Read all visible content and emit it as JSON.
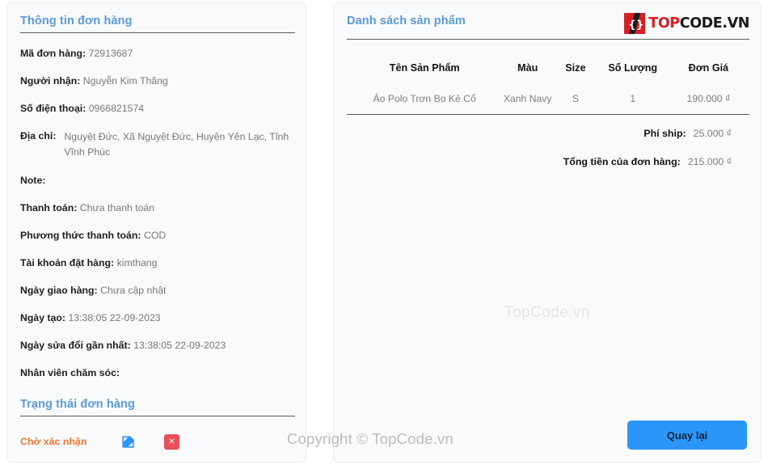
{
  "left": {
    "title": "Thông tin đơn hàng",
    "fields": [
      {
        "label": "Mã đơn hàng:",
        "value": "72913687"
      },
      {
        "label": "Người nhận:",
        "value": "Nguyễn Kim Thăng"
      },
      {
        "label": "Số điện thoại:",
        "value": "0966821574"
      },
      {
        "label": "Địa chỉ:",
        "value": "Nguyệt Đức, Xã Nguyệt Đức, Huyện Yên Lạc, Tỉnh Vĩnh Phúc"
      },
      {
        "label": "Note:",
        "value": ""
      },
      {
        "label": "Thanh toán:",
        "value": "Chưa thanh toán"
      },
      {
        "label": "Phương thức thanh toán:",
        "value": "COD"
      },
      {
        "label": "Tài khoản đặt hàng:",
        "value": "kimthang"
      },
      {
        "label": "Ngày giao hàng:",
        "value": "Chưa cập nhật"
      },
      {
        "label": "Ngày tạo:",
        "value": "13:38:05 22-09-2023"
      },
      {
        "label": "Ngày sửa đổi gần nhất:",
        "value": "13:38:05 22-09-2023"
      },
      {
        "label": "Nhân viên chăm sóc:",
        "value": ""
      }
    ],
    "status_title": "Trạng thái đơn hàng",
    "status_text": "Chờ xác nhận",
    "edit_icon": "edit-pencil-square-icon",
    "delete_icon": "close-x-icon",
    "delete_glyph": "✕"
  },
  "right": {
    "title": "Danh sách sản phẩm",
    "logo": {
      "mark_icon": "code-braces-icon",
      "text_part1": "TOP",
      "text_part2": "CODE",
      "text_part3": ".VN"
    },
    "table": {
      "headers": [
        "Tên Sản Phẩm",
        "Màu",
        "Size",
        "Số Lượng",
        "Đơn Giá"
      ],
      "rows": [
        {
          "name": "Áo Polo Trơn Bo Kẻ Cổ",
          "color": "Xanh Navy",
          "size": "S",
          "qty": "1",
          "price": "190.000 ₫"
        }
      ]
    },
    "totals": [
      {
        "label": "Phí ship:",
        "value": "25.000 ₫"
      },
      {
        "label": "Tổng tiền của đơn hàng:",
        "value": "215.000 ₫"
      }
    ],
    "watermark": "TopCode.vn",
    "back_button": "Quay lại"
  },
  "page": {
    "copyright_watermark": "Copyright © TopCode.vn"
  },
  "colors": {
    "heading_blue": "#5a9bd8",
    "status_orange": "#ee7733",
    "button_blue": "#2b96f7",
    "delete_red": "#e8505a",
    "logo_red": "#d61f26",
    "panel_bg": "#f9fafb",
    "divider": "#575b60"
  }
}
